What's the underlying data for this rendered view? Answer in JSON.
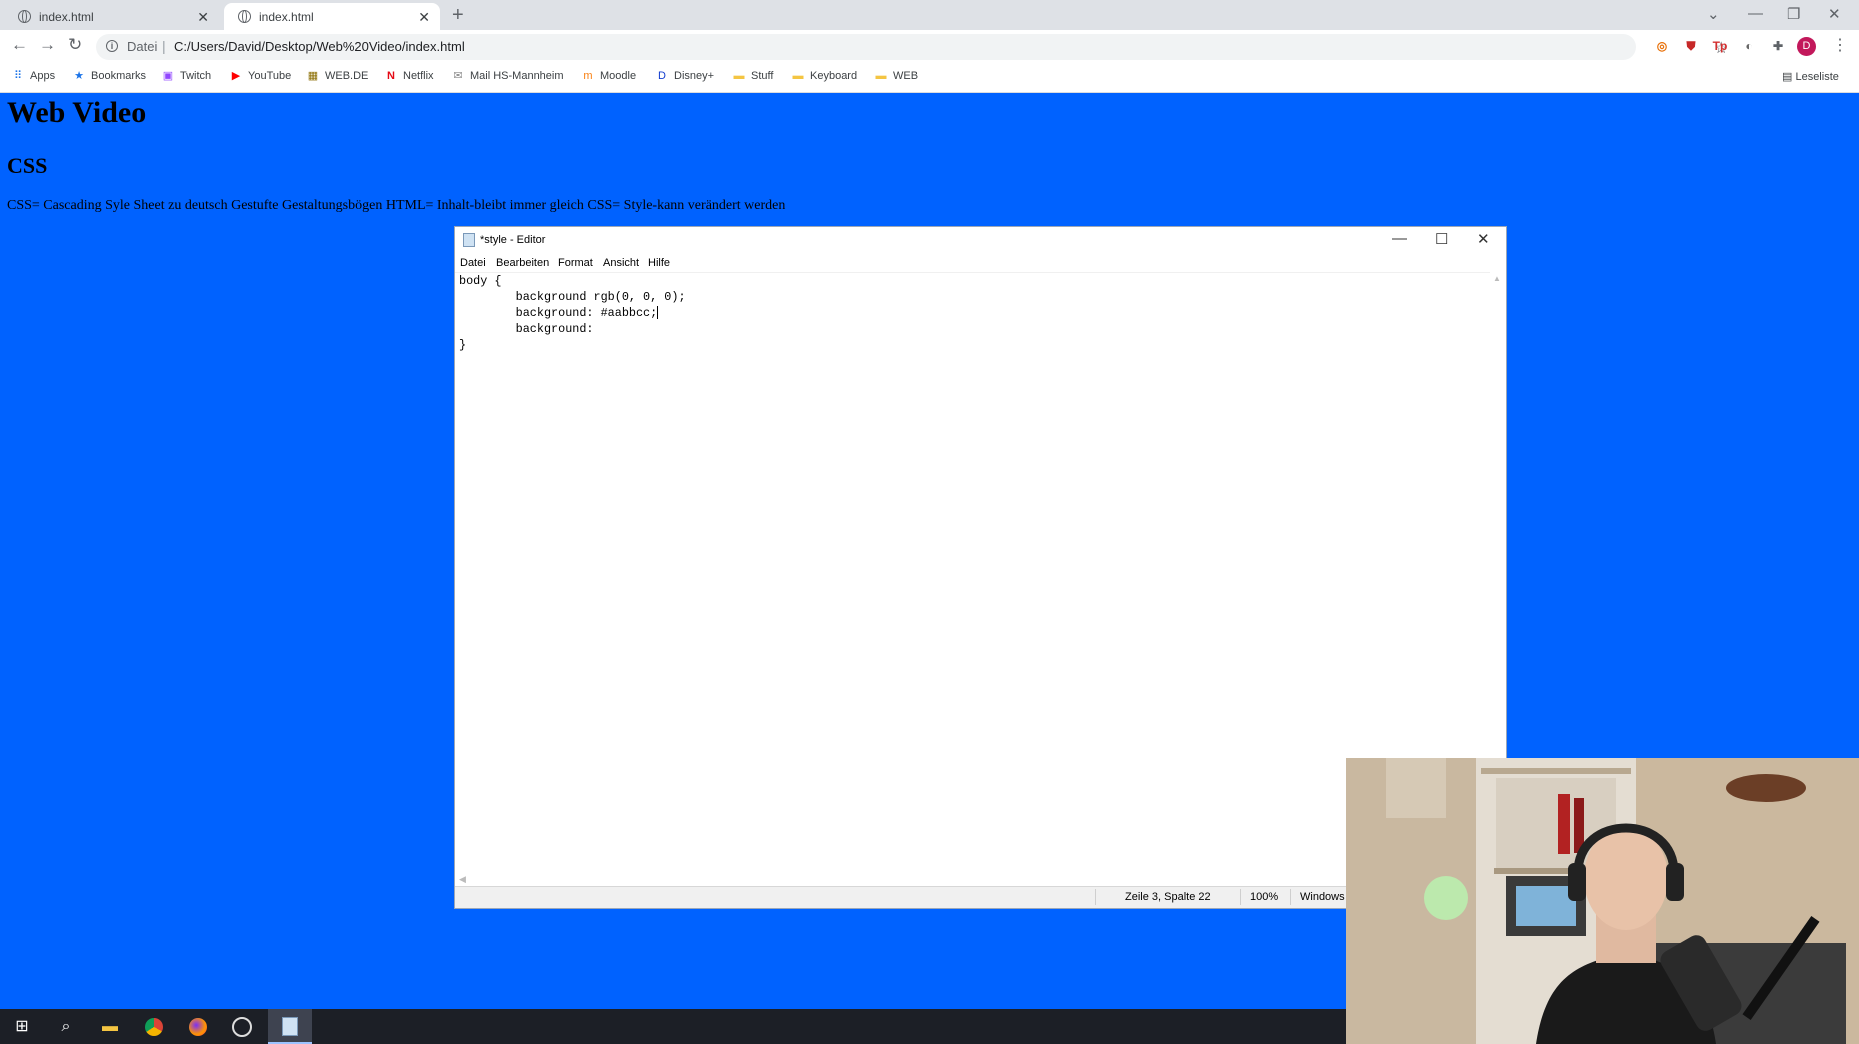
{
  "browser": {
    "tabs": [
      {
        "title": "index.html",
        "active": false
      },
      {
        "title": "index.html",
        "active": true
      }
    ],
    "new_tab": "+",
    "address": {
      "scheme_label": "Datei",
      "separator": "|",
      "url": "C:/Users/David/Desktop/Web%20Video/index.html"
    },
    "profile_initial": "D",
    "bookmarks": [
      {
        "label": "Apps",
        "icon": "apps-grid-icon"
      },
      {
        "label": "Bookmarks",
        "icon": "star-icon"
      },
      {
        "label": "Twitch",
        "icon": "twitch-icon"
      },
      {
        "label": "YouTube",
        "icon": "youtube-icon"
      },
      {
        "label": "WEB.DE",
        "icon": "webde-icon"
      },
      {
        "label": "Netflix",
        "icon": "netflix-icon"
      },
      {
        "label": "Mail HS-Mannheim",
        "icon": "mail-icon"
      },
      {
        "label": "Moodle",
        "icon": "moodle-icon"
      },
      {
        "label": "Disney+",
        "icon": "disney-icon"
      },
      {
        "label": "Stuff",
        "icon": "folder-icon"
      },
      {
        "label": "Keyboard",
        "icon": "folder-icon"
      },
      {
        "label": "WEB",
        "icon": "folder-icon"
      }
    ],
    "reading_list": "Leseliste"
  },
  "page": {
    "heading": "Web Video",
    "subheading": "CSS",
    "paragraph": "CSS= Cascading Syle Sheet zu deutsch Gestufte Gestaltungsbögen HTML= Inhalt-bleibt immer gleich CSS= Style-kann verändert werden",
    "background_color": "#0062ff"
  },
  "notepad": {
    "title": "*style - Editor",
    "menu": [
      "Datei",
      "Bearbeiten",
      "Format",
      "Ansicht",
      "Hilfe"
    ],
    "lines": [
      "body {",
      "        background rgb(0, 0, 0);",
      "        background: #aabbcc;",
      "        background:",
      "",
      "}"
    ],
    "status": {
      "position": "Zeile 3, Spalte 22",
      "zoom": "100%",
      "encoding": "Windows ("
    }
  },
  "taskbar": {
    "items": [
      {
        "name": "start-button",
        "icon": "windows-icon"
      },
      {
        "name": "search-button",
        "icon": "search-icon"
      },
      {
        "name": "file-explorer-button",
        "icon": "folder-icon"
      },
      {
        "name": "chrome-button",
        "icon": "chrome-icon"
      },
      {
        "name": "firefox-button",
        "icon": "firefox-icon"
      },
      {
        "name": "obs-button",
        "icon": "obs-icon"
      },
      {
        "name": "notepad-button",
        "icon": "notepad-icon",
        "active": true
      }
    ]
  }
}
